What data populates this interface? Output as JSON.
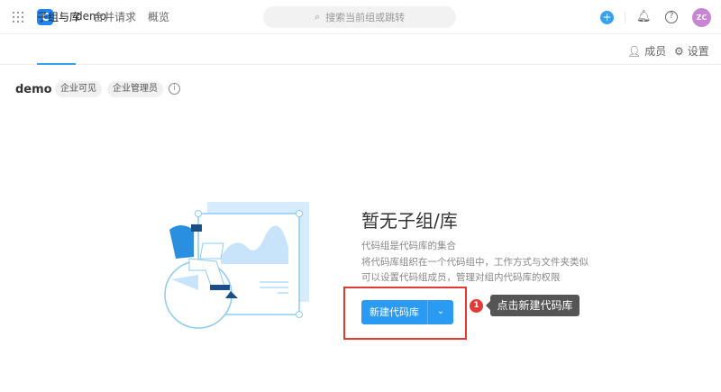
{
  "topbar": {
    "breadcrumb": "demo",
    "search_placeholder": "搜索当前组或跳转",
    "avatar_initials": "ZC",
    "logo_letter": "C"
  },
  "tabs": [
    {
      "label": "子组与库",
      "active": true
    },
    {
      "label": "合并请求"
    },
    {
      "label": "概览"
    }
  ],
  "actions": {
    "members": "成员",
    "settings": "设置"
  },
  "group": {
    "name": "demo",
    "badges": [
      "企业可见",
      "企业管理员"
    ]
  },
  "empty": {
    "title": "暂无子组/库",
    "lines": [
      "代码组是代码库的集合",
      "将代码库组织在一个代码组中，工作方式与文件夹类似",
      "可以设置代码组成员，管理对组内代码库的权限"
    ],
    "button": "新建代码库"
  },
  "annotation": {
    "step": "1",
    "tip": "点击新建代码库"
  },
  "colors": {
    "accent": "#2b9af3",
    "highlight": "#e53935"
  }
}
